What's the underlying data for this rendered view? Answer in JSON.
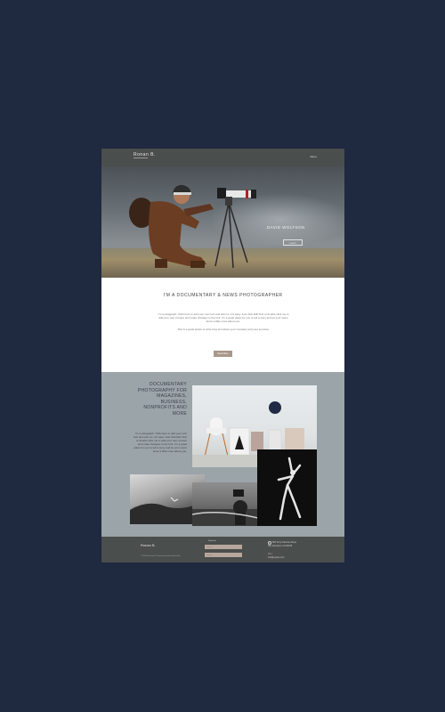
{
  "header": {
    "logo": "Ronan B.",
    "nav_item": "Menu"
  },
  "hero": {
    "title": "DAVID WOLFSON",
    "button_label": "Learn"
  },
  "about": {
    "title": "I'M A DOCUMENTARY & NEWS PHOTOGRAPHER",
    "paragraph1": "I'm a paragraph. Click here to add your own text and edit me. It's easy. Just click Edit Text or double click me to add your own content and make changes to the font. I'm a great place for you to tell a story and let your users know a little more about you.",
    "paragraph2": "This is a great space to write long text about your company and your services.",
    "button_label": "Read More"
  },
  "services": {
    "title": "DOCUMENTARY PHOTOGRAPHY FOR MAGAZINES, BUSINESS, NONPROFITS AND MORE",
    "description": "I'm a paragraph. Click here to add your own text and edit me. It's easy. Just click Edit Text or double click me to add your own content and make changes to the font. I'm a great place for you to tell a story and let your users know a little more about you."
  },
  "footer": {
    "logo": "Ronan B.",
    "copyright": "© 2035 by Ronan B. Powered and secured by Wix",
    "newsletter_heading": "Subscribe",
    "name_placeholder": "Name",
    "email_placeholder": "Email",
    "address_line1": "500 Terry Francine Street",
    "address_line2": "San Francisco, CA 94158",
    "phone": "Tel: 123-456-7890",
    "email": "info@mysite.com",
    "social": "f   in   t"
  },
  "colors": {
    "page_bg": "#1f2940",
    "header_bg": "#4a4e4c",
    "services_bg": "#9ba4a8",
    "accent_button": "#a89889"
  }
}
